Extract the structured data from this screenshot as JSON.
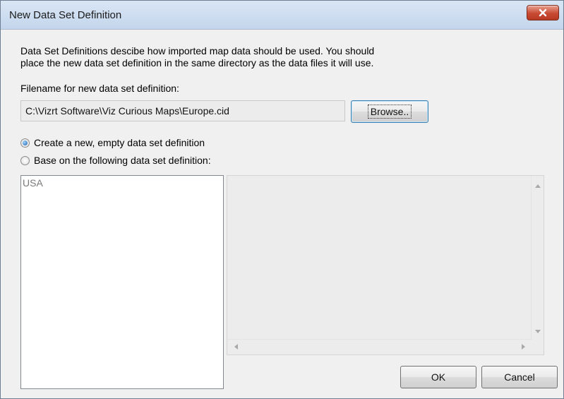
{
  "window": {
    "title": "New Data Set Definition",
    "close_icon": "close-x-icon"
  },
  "description": {
    "line1": "Data Set Definitions descibe how imported map data should be used. You should",
    "line2": "place the new data set definition in the same directory as the data files it will use."
  },
  "filename": {
    "label": "Filename for new data set definition:",
    "value": "C:\\Vizrt Software\\Viz Curious Maps\\Europe.cid",
    "browse_label": "Browse.."
  },
  "options": {
    "create_new_label": "Create a new, empty data set definition",
    "create_new_checked": true,
    "base_on_label": "Base on the following data set definition:",
    "base_on_checked": false
  },
  "definitions_list": {
    "items": [
      "USA"
    ]
  },
  "buttons": {
    "ok_label": "OK",
    "cancel_label": "Cancel"
  },
  "colors": {
    "close_button": "#c84a32",
    "titlebar": "#c4d6ec",
    "radio_accent": "#1d5fa8"
  }
}
